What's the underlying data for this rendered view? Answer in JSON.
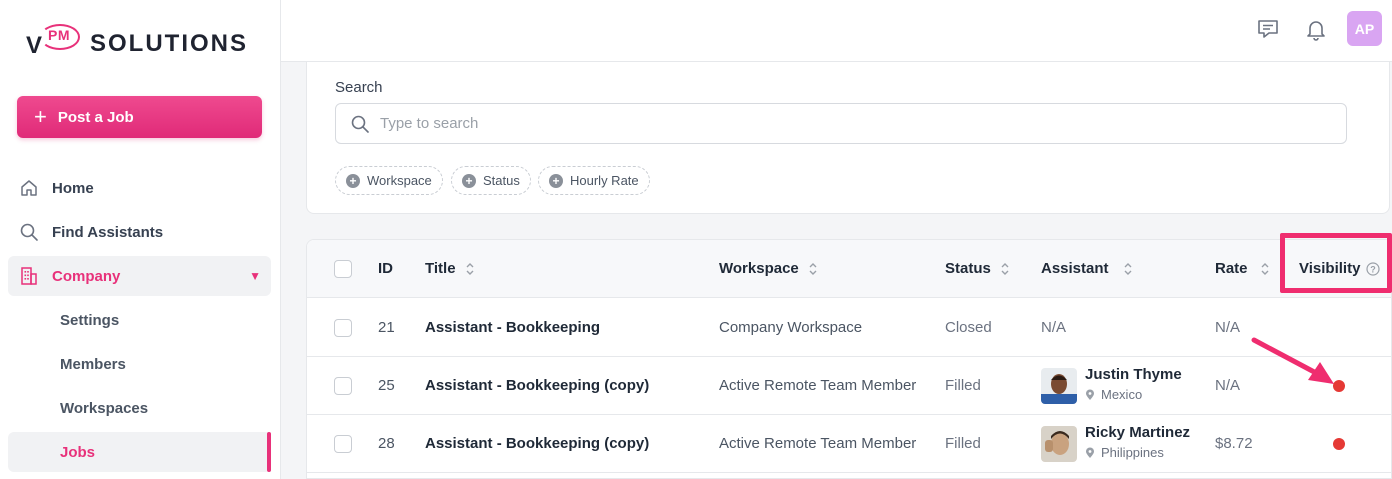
{
  "brand": {
    "logo_letter": "V",
    "logo_pm": "PM",
    "logo_text": "SOLUTIONS",
    "accent": "#e8317a"
  },
  "sidebar": {
    "post_job_label": "Post a Job",
    "items": [
      {
        "label": "Home",
        "icon": "home-icon"
      },
      {
        "label": "Find Assistants",
        "icon": "search-icon"
      },
      {
        "label": "Company",
        "icon": "building-icon",
        "expanded": true
      }
    ],
    "subitems": [
      {
        "label": "Settings"
      },
      {
        "label": "Members"
      },
      {
        "label": "Workspaces"
      },
      {
        "label": "Jobs",
        "active": true
      }
    ]
  },
  "topbar": {
    "avatar_initials": "AP",
    "avatar_color": "#d9a5f2"
  },
  "search": {
    "label": "Search",
    "placeholder": "Type to search",
    "filters": [
      "Workspace",
      "Status",
      "Hourly Rate"
    ]
  },
  "table": {
    "columns": {
      "id": "ID",
      "title": "Title",
      "workspace": "Workspace",
      "status": "Status",
      "assistant": "Assistant",
      "rate": "Rate",
      "visibility": "Visibility"
    },
    "rows": [
      {
        "id": "21",
        "title": "Assistant - Bookkeeping",
        "workspace": "Company Workspace",
        "status": "Closed",
        "assistant": "N/A",
        "rate": "N/A"
      },
      {
        "id": "25",
        "title": "Assistant - Bookkeeping (copy)",
        "workspace": "Active Remote Team Member",
        "status": "Filled",
        "assistant_name": "Justin Thyme",
        "assistant_location": "Mexico",
        "rate": "N/A",
        "visibility_color": "#e53935"
      },
      {
        "id": "28",
        "title": "Assistant - Bookkeeping (copy)",
        "workspace": "Active Remote Team Member",
        "status": "Filled",
        "assistant_name": "Ricky Martinez",
        "assistant_location": "Philippines",
        "rate": "$8.72",
        "visibility_color": "#e53935"
      }
    ]
  },
  "annotation": {
    "highlight_color": "#ef2d6f"
  }
}
